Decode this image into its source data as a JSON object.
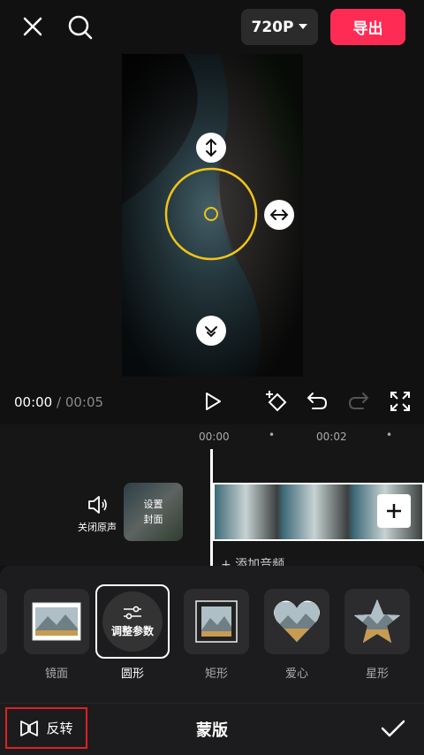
{
  "topbar": {
    "resolution": "720P",
    "export": "导出"
  },
  "player": {
    "current_time": "00:00",
    "separator": " / ",
    "duration": "00:05"
  },
  "timeline": {
    "ruler_0": "00:00",
    "ruler_1": "00:02",
    "mute_label": "关闭原声",
    "cover_label_1": "设置",
    "cover_label_2": "封面",
    "add_audio": "+ 添加音频"
  },
  "masks": [
    {
      "label": "镜面",
      "icon": "mirror-mask-icon"
    },
    {
      "label": "圆形",
      "icon": "circle-mask-icon",
      "selected": true,
      "badge": "调整参数"
    },
    {
      "label": "矩形",
      "icon": "rectangle-mask-icon"
    },
    {
      "label": "爱心",
      "icon": "heart-mask-icon"
    },
    {
      "label": "星形",
      "icon": "star-mask-icon"
    }
  ],
  "bottombar": {
    "invert": "反转",
    "title": "蒙版"
  },
  "colors": {
    "accent": "#fe2c55",
    "mask_outline": "#f0c419",
    "highlight_box": "#e02020"
  }
}
